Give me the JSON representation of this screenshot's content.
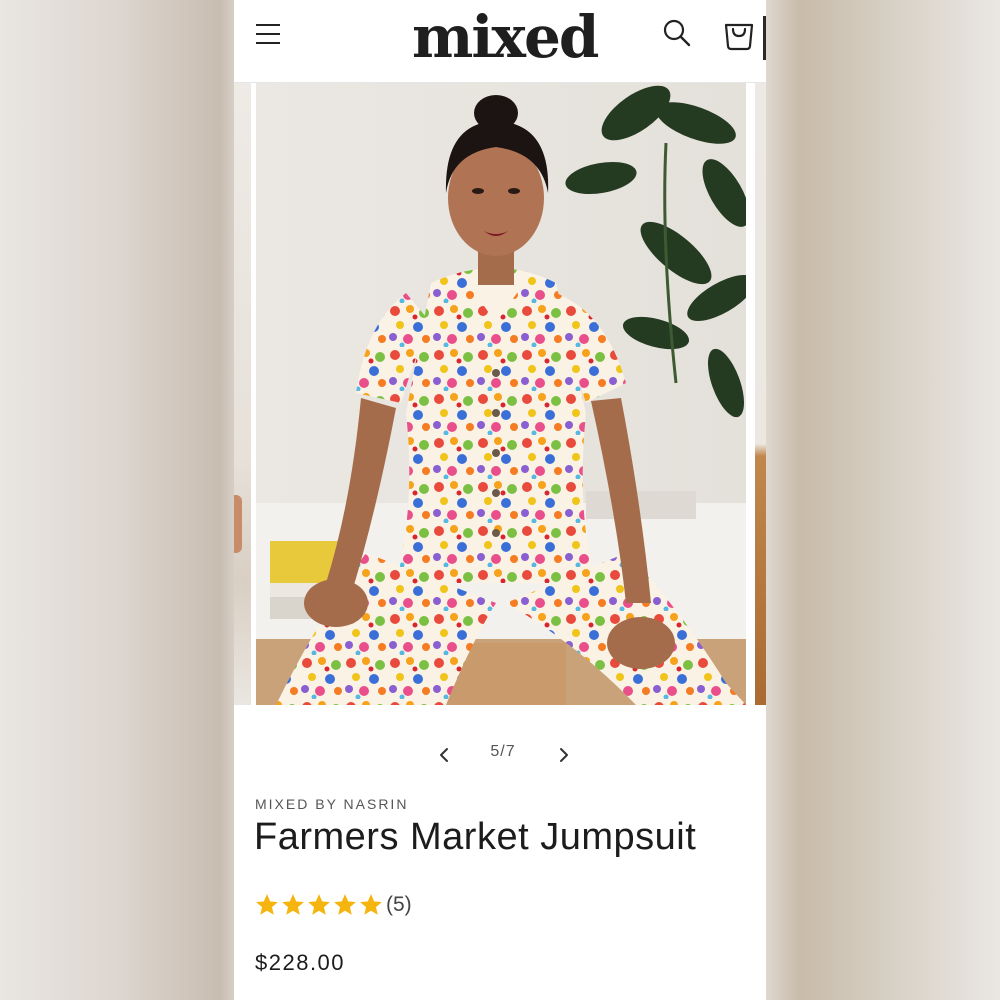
{
  "header": {
    "logo_text": "mixed",
    "menu_icon": "hamburger-menu-icon",
    "search_icon": "search-icon",
    "cart_icon": "cart-icon"
  },
  "gallery": {
    "current": "5",
    "total": "7",
    "counter_text": "5/7",
    "prev_icon": "chevron-left-icon",
    "next_icon": "chevron-right-icon",
    "image_description": "model-in-floral-jumpsuit"
  },
  "product": {
    "vendor": "MIXED BY NASRIN",
    "title": "Farmers Market Jumpsuit",
    "rating_value": 5,
    "rating_max": 5,
    "rating_count_text": "(5)",
    "price": "$228.00"
  },
  "colors": {
    "star": "#f6b40e",
    "text": "#1c1c1c",
    "muted": "#555555"
  }
}
